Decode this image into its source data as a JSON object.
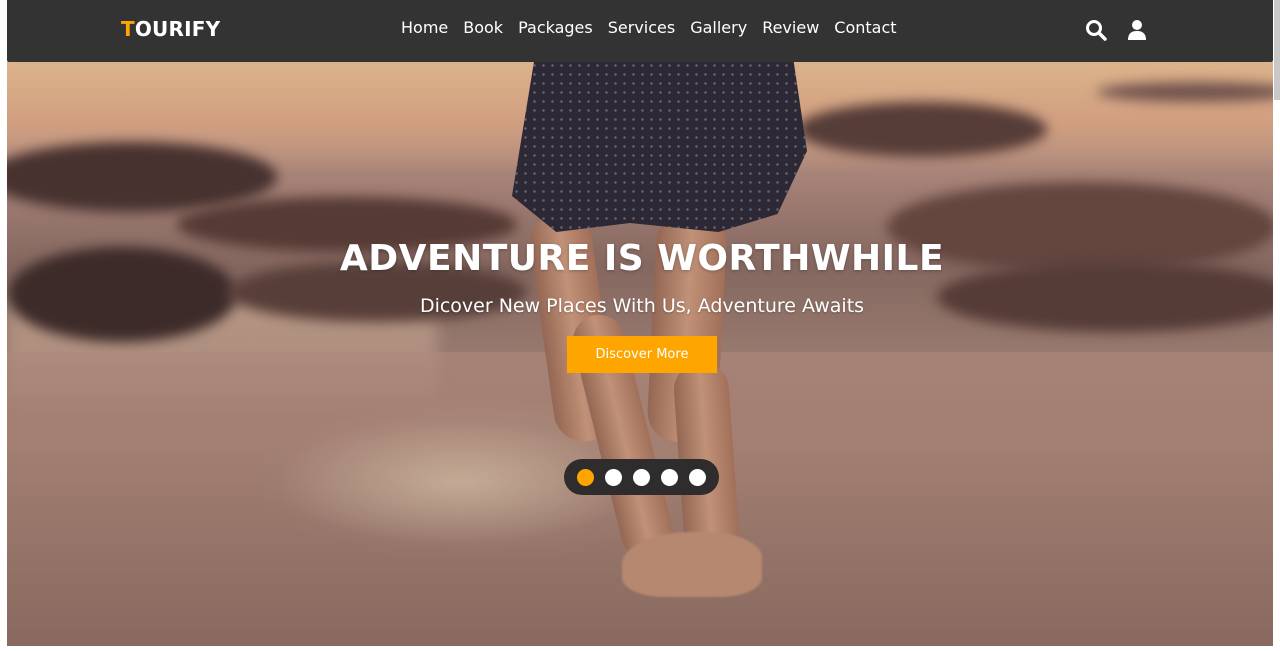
{
  "header": {
    "logo_first": "T",
    "logo_rest": "OURIFY",
    "nav": [
      {
        "label": "Home"
      },
      {
        "label": "Book"
      },
      {
        "label": "Packages"
      },
      {
        "label": "Services"
      },
      {
        "label": "Gallery"
      },
      {
        "label": "Review"
      },
      {
        "label": "Contact"
      }
    ],
    "icons": [
      "search-icon",
      "user-icon"
    ]
  },
  "hero": {
    "title": "ADVENTURE IS WORTHWHILE",
    "subtitle": "Dicover New Places With Us, Adventure Awaits",
    "cta_label": "Discover More",
    "slides_total": 5,
    "active_slide": 1
  },
  "colors": {
    "accent": "#ffa500",
    "header_bg": "#333333",
    "text": "#ffffff"
  }
}
